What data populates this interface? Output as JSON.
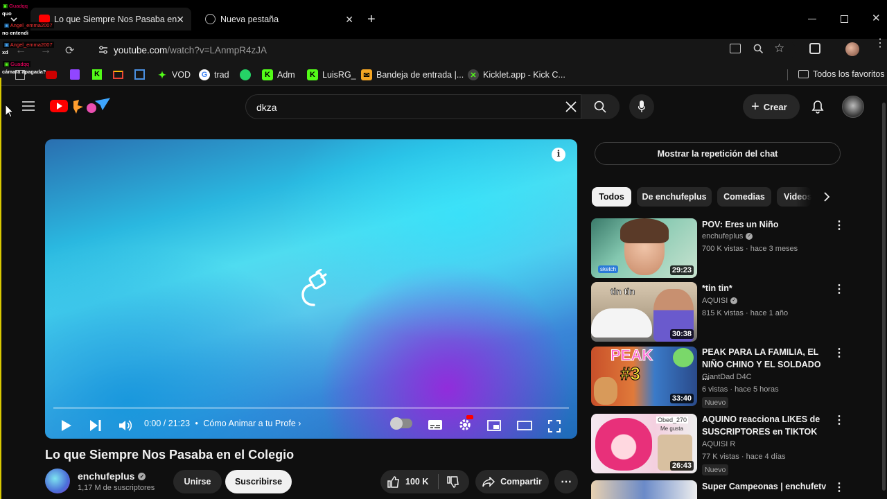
{
  "browser": {
    "tabs": [
      {
        "label": "Lo que Siempre Nos Pasaba en",
        "active": true
      },
      {
        "label": "Nueva pestaña",
        "active": false
      }
    ],
    "url_host": "youtube.com",
    "url_path": "/watch?v=LAnmpR4zJA",
    "bookmarks": [
      "VOD",
      "trad",
      "Adm",
      "LuisRG_",
      "Bandeja de entrada |...",
      "Kicklet.app - Kick C..."
    ],
    "all_bookmarks": "Todos los favoritos"
  },
  "overlay_chat": [
    {
      "user": "Guadqq",
      "msg": "quo"
    },
    {
      "user": "Angel_emma2007",
      "msg": "no entendi"
    },
    {
      "user": "Angel_emma2007",
      "msg": "xd"
    },
    {
      "user": "Guadqq",
      "msg": "cámara apagada?"
    }
  ],
  "youtube": {
    "search_value": "dkza",
    "create_label": "Crear",
    "chat_replay": "Mostrar la repetición del chat",
    "chips": [
      "Todos",
      "De enchufeplus",
      "Comedias",
      "Videos"
    ],
    "player": {
      "time": "0:00 / 21:23",
      "chapter": "Cómo Animar a tu Profe",
      "progress": 0.0
    },
    "video_title": "Lo que Siempre Nos Pasaba en el Colegio",
    "channel": {
      "name": "enchufeplus",
      "subs": "1,17 M de suscriptores"
    },
    "join_label": "Unirse",
    "subscribe_label": "Suscribirse",
    "likes": "100 K",
    "share_label": "Compartir",
    "recommendations": [
      {
        "title": "POV: Eres un Niño",
        "channel": "enchufeplus",
        "verified": true,
        "meta": "700 K vistas · hace 3 meses",
        "duration": "29:23",
        "badge": ""
      },
      {
        "title": "*tin tin*",
        "channel": "AQUISI",
        "verified": true,
        "meta": "815 K vistas · hace 1 año",
        "duration": "30:38",
        "badge": ""
      },
      {
        "title": "PEAK PARA LA FAMILIA, EL NIÑO CHINO Y EL SOLDADO ...",
        "channel": "GiantDad D4C",
        "verified": false,
        "meta": "6 vistas · hace 5 horas",
        "duration": "33:40",
        "badge": "Nuevo"
      },
      {
        "title": "AQUINO reacciona LIKES de SUSCRIPTORES en TIKTOK",
        "channel": "AQUISI R",
        "verified": false,
        "meta": "77 K vistas · hace 4 días",
        "duration": "26:43",
        "badge": "Nuevo"
      },
      {
        "title": "Super Campeonas | enchufetv",
        "channel": "",
        "verified": false,
        "meta": "",
        "duration": "",
        "badge": ""
      }
    ],
    "thumb_texts": {
      "t1": "sketch",
      "t2": "tin tin",
      "t3a": "PEAK",
      "t3b": "#3",
      "t4a": "Obed_270",
      "t4b": "Me gusta"
    }
  },
  "colors": {
    "yt_red": "#ff0000",
    "bg": "#0f0f0f",
    "chip_active": "#f1f1f1"
  }
}
